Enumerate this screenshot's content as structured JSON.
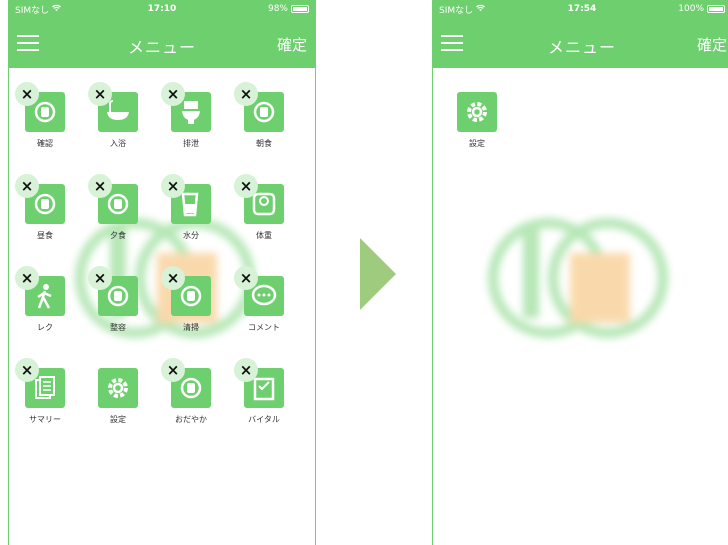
{
  "left_phone": {
    "status": {
      "carrier": "SIMなし",
      "time": "17:10",
      "battery": "98%",
      "battery_level": 0.98
    },
    "nav": {
      "title": "メニュー",
      "confirm": "確定"
    },
    "tiles": [
      {
        "label": "確認",
        "icon": "nurse-cap-icon",
        "deletable": true
      },
      {
        "label": "入浴",
        "icon": "bathtub-icon",
        "deletable": true
      },
      {
        "label": "排泄",
        "icon": "toilet-icon",
        "deletable": true
      },
      {
        "label": "朝食",
        "icon": "breakfast-icon",
        "deletable": true
      },
      {
        "label": "昼食",
        "icon": "lunch-icon",
        "deletable": true
      },
      {
        "label": "夕食",
        "icon": "dinner-icon",
        "deletable": true
      },
      {
        "label": "水分",
        "icon": "water-glass-icon",
        "deletable": true
      },
      {
        "label": "体重",
        "icon": "scale-icon",
        "deletable": true
      },
      {
        "label": "レク",
        "icon": "walking-person-icon",
        "deletable": true
      },
      {
        "label": "整容",
        "icon": "grooming-icon",
        "deletable": true
      },
      {
        "label": "清掃",
        "icon": "cleaning-icon",
        "deletable": true
      },
      {
        "label": "コメント",
        "icon": "speech-bubble-icon",
        "deletable": true
      },
      {
        "label": "サマリー",
        "icon": "documents-icon",
        "deletable": true
      },
      {
        "label": "設定",
        "icon": "gear-icon",
        "deletable": false
      },
      {
        "label": "おだやか",
        "icon": "calm-icon",
        "deletable": true
      },
      {
        "label": "バイタル",
        "icon": "clipboard-icon",
        "deletable": true
      }
    ]
  },
  "right_phone": {
    "status": {
      "carrier": "SIMなし",
      "time": "17:54",
      "battery": "100%",
      "battery_level": 1.0
    },
    "nav": {
      "title": "メニュー",
      "confirm": "確定"
    },
    "tiles": [
      {
        "label": "設定",
        "icon": "gear-icon",
        "deletable": false
      }
    ]
  },
  "colors": {
    "brand_green": "#6dcf6d",
    "arrow_green": "#9fcb7e",
    "delete_badge_bg": "#d7f2d7"
  }
}
